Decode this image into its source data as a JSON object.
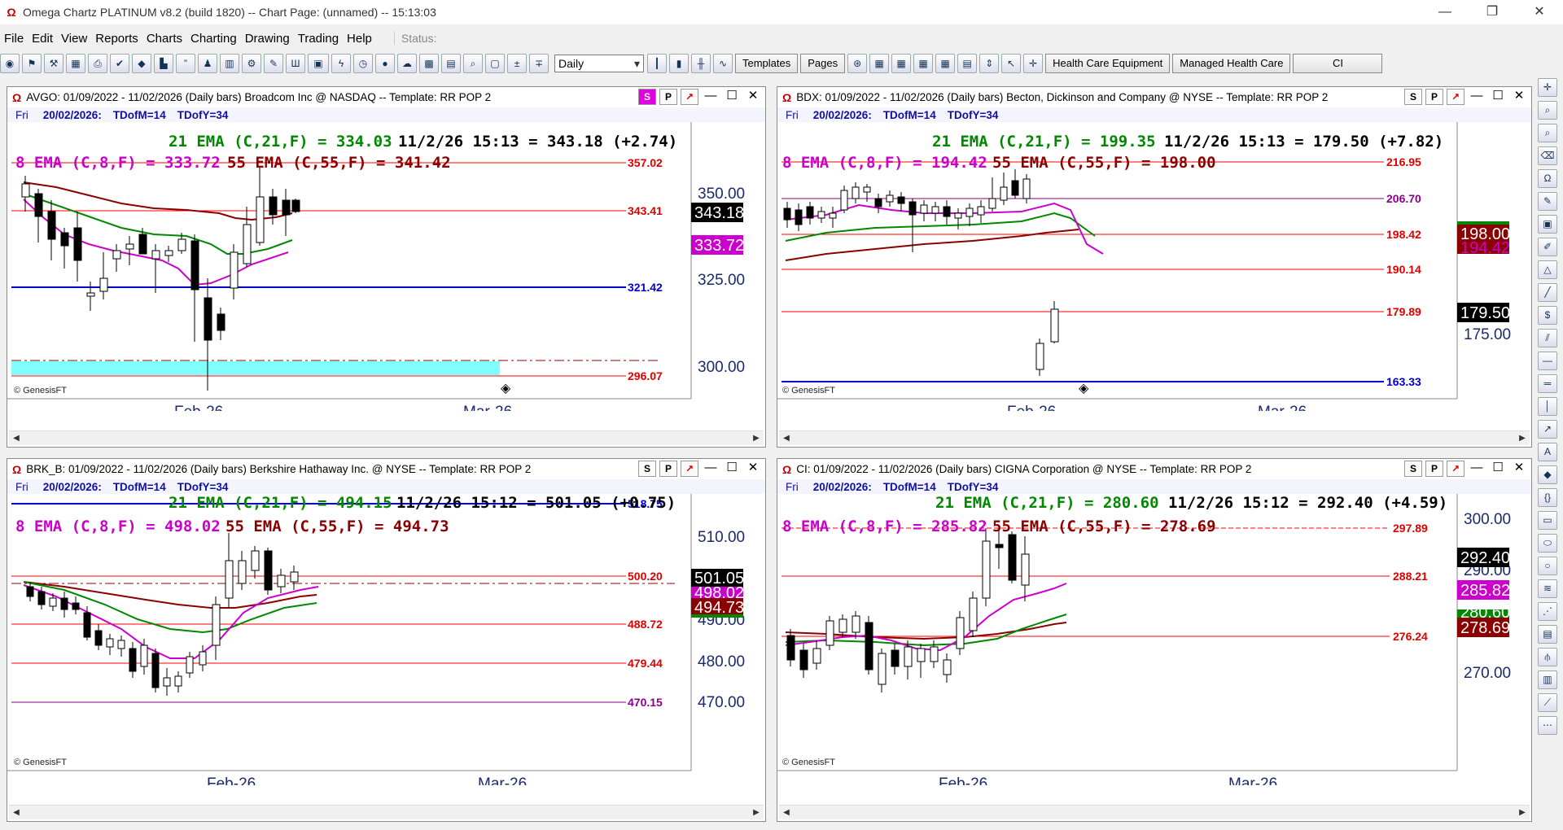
{
  "window": {
    "title": "Omega Chartz PLATINUM v8.2 (build 1820)  --  Chart Page: (unnamed) -- 15:13:03",
    "controls": {
      "minimize": "—",
      "restore": "❐",
      "close": "✕"
    }
  },
  "menu": {
    "items": [
      "File",
      "Edit",
      "View",
      "Reports",
      "Charts",
      "Charting",
      "Drawing",
      "Trading",
      "Help"
    ],
    "status_label": "Status:"
  },
  "toolbar": {
    "period": "Daily",
    "buttons": [
      "Templates",
      "Pages",
      "Health Care Equipment",
      "Managed Health Care",
      "CI"
    ]
  },
  "colors": {
    "ema8": "#cc00cc",
    "ema21": "#008800",
    "ema55": "#8b0000",
    "hline": "#ff0000",
    "bline": "#0000cc",
    "zone": "#80ffff"
  },
  "panels": [
    {
      "id": "avgo",
      "title": "AVGO: 01/09/2022 - 11/02/2026  (Daily bars)   Broadcom Inc @ NASDAQ  --  Template: RR POP 2",
      "btns": [
        "S",
        "P"
      ],
      "sub": {
        "day": "Fri",
        "date": "20/02/2026:",
        "tdm": "TDofM=14",
        "tdy": "TDofY=34"
      },
      "ema21_text": "21 EMA (C,21,F) = 334.03",
      "price_text": "11/2/26 15:13 = 343.18 (+2.74)",
      "ema8_text": "8 EMA (C,8,F) = 333.72",
      "ema55_text": "55 EMA (C,55,F) = 341.42",
      "levels": [
        "357.02",
        "343.41",
        "321.42",
        "296.07"
      ],
      "axis": [
        "350.00",
        "325.00",
        "300.00"
      ],
      "tags": [
        "343.18",
        "333.72"
      ],
      "months": [
        "Feb-26",
        "Mar-26"
      ],
      "credit": "© GenesisFT"
    },
    {
      "id": "bdx",
      "title": "BDX: 01/09/2022 - 11/02/2026  (Daily bars)   Becton, Dickinson and Company @ NYSE  --  Template: RR POP 2",
      "btns": [
        "S",
        "P"
      ],
      "sub": {
        "day": "Fri",
        "date": "20/02/2026:",
        "tdm": "TDofM=14",
        "tdy": "TDofY=34"
      },
      "ema21_text": "21 EMA (C,21,F) = 199.35",
      "price_text": "11/2/26 15:13 = 179.50 (+7.82)",
      "ema8_text": "8 EMA (C,8,F) = 194.42",
      "ema55_text": "55 EMA (C,55,F) = 198.00",
      "levels": [
        "216.95",
        "206.70",
        "198.42",
        "190.14",
        "179.89",
        "163.33"
      ],
      "axis": [
        "175.00"
      ],
      "tags": [
        "198.00",
        "194.42",
        "179.50"
      ],
      "months": [
        "Feb-26",
        "Mar-26"
      ],
      "credit": "© GenesisFT"
    },
    {
      "id": "brkb",
      "title": "BRK_B: 01/09/2022 - 11/02/2026  (Daily bars)   Berkshire Hathaway Inc. @ NYSE  --  Template: RR POP 2",
      "btns": [
        "S",
        "P"
      ],
      "sub": {
        "day": "Fri",
        "date": "20/02/2026:",
        "tdm": "TDofM=14",
        "tdy": "TDofY=34"
      },
      "ema21_text": "21 EMA (C,21,F) = 494.15",
      "price_text": "11/2/26 15:12 = 501.05 (+0.75)",
      "ema8_text": "8 EMA (C,8,F) = 498.02",
      "ema55_text": "55 EMA (C,55,F) = 494.73",
      "levels": [
        "518.75",
        "500.20",
        "488.72",
        "479.44",
        "470.15"
      ],
      "axis": [
        "510.00",
        "490.00",
        "480.00",
        "470.00"
      ],
      "tags": [
        "501.05",
        "498.02",
        "494.73"
      ],
      "months": [
        "Feb-26",
        "Mar-26"
      ],
      "credit": "© GenesisFT"
    },
    {
      "id": "ci",
      "title": "CI: 01/09/2022 - 11/02/2026  (Daily bars)   CIGNA Corporation @ NYSE  --  Template: RR POP 2",
      "btns": [
        "S",
        "P"
      ],
      "sub": {
        "day": "Fri",
        "date": "20/02/2026:",
        "tdm": "TDofM=14",
        "tdy": "TDofY=34"
      },
      "ema21_text": "21 EMA (C,21,F) = 280.60",
      "price_text": "11/2/26 15:12 = 292.40 (+4.59)",
      "ema8_text": "8 EMA (C,8,F) = 285.82",
      "ema55_text": "55 EMA (C,55,F) = 278.69",
      "levels": [
        "297.89",
        "288.21",
        "276.24"
      ],
      "axis": [
        "300.00",
        "290.00",
        "270.00"
      ],
      "tags": [
        "292.40",
        "285.82",
        "280.60",
        "278.69"
      ],
      "months": [
        "Feb-26",
        "Mar-26"
      ],
      "credit": "© GenesisFT"
    }
  ]
}
